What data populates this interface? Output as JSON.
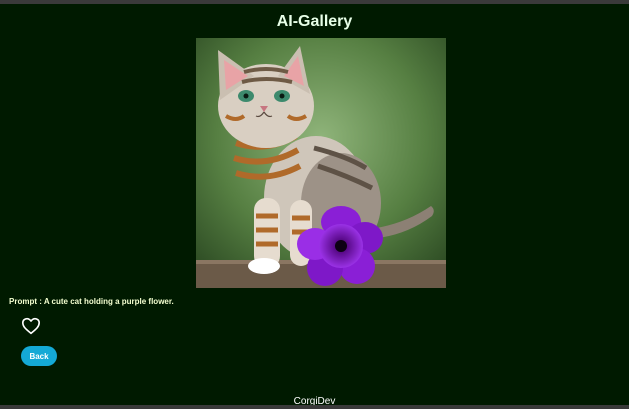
{
  "app": {
    "title": "AI-Gallery"
  },
  "image": {
    "subject": "cat-with-purple-flower",
    "prompt_label": "Prompt : ",
    "prompt_text": "A cute cat holding a purple flower."
  },
  "actions": {
    "like_icon": "heart-outline-icon",
    "back_label": "Back"
  },
  "footer": {
    "text": "CorgiDev"
  },
  "colors": {
    "background": "#001a00",
    "title": "#e8ffe8",
    "prompt_text": "#f4ffd0",
    "button": "#14a9d6",
    "flower": "#8a1fd6"
  }
}
